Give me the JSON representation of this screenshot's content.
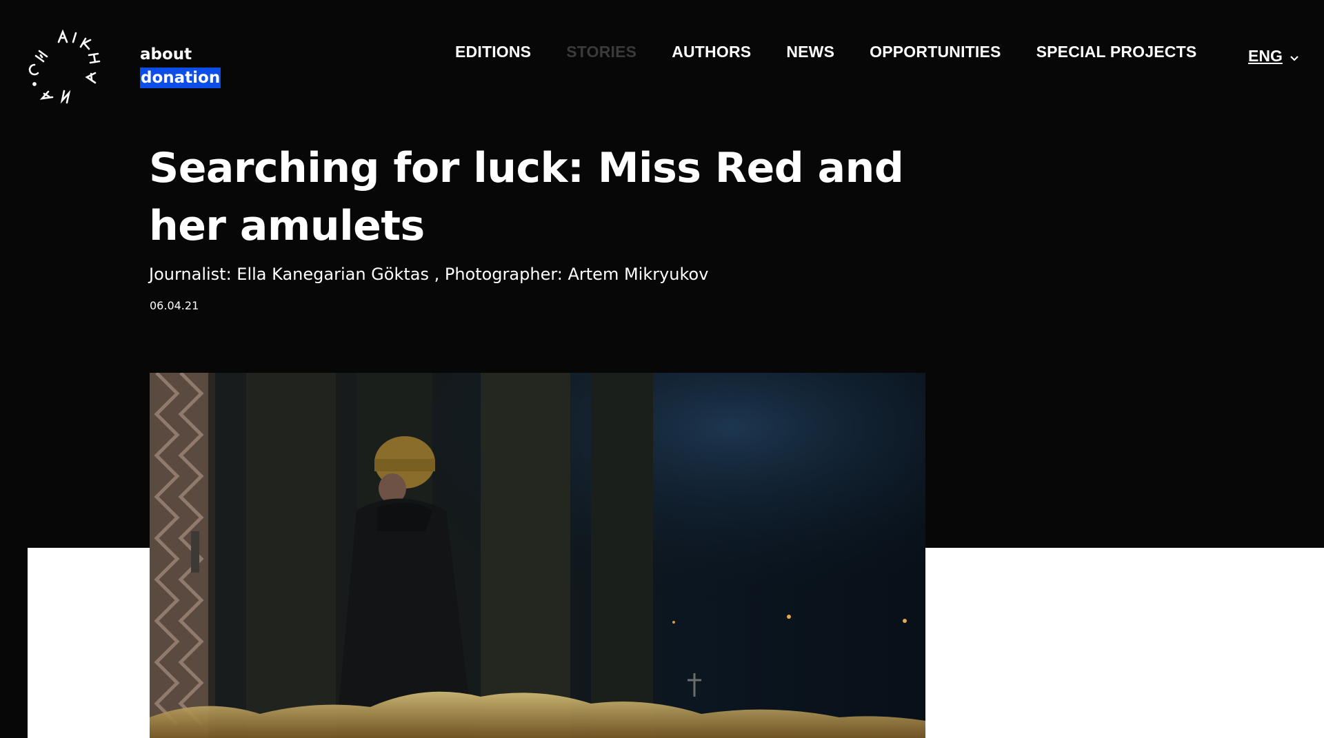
{
  "logo": {
    "text": "CHAIKHANA",
    "icon": "circular-wordmark-logo"
  },
  "side_links": {
    "about": "about",
    "donation": "donation"
  },
  "nav": {
    "items": [
      {
        "label": "EDITIONS",
        "active": false
      },
      {
        "label": "STORIES",
        "active": true
      },
      {
        "label": "AUTHORS",
        "active": false
      },
      {
        "label": "NEWS",
        "active": false
      },
      {
        "label": "OPPORTUNITIES",
        "active": false
      },
      {
        "label": "SPECIAL PROJECTS",
        "active": false
      }
    ],
    "language": "ENG",
    "language_icon": "chevron-down-icon"
  },
  "article": {
    "title": "Searching for luck: Miss Red and her amulets",
    "credits": "Journalist: Ella Kanegarian Göktas ,  Photographer: Artem Mikryukov",
    "date": "06.04.21"
  },
  "colors": {
    "background": "#070707",
    "donation_highlight": "#0d4de8",
    "active_nav": "#3a3a3a",
    "panel": "#ffffff"
  }
}
